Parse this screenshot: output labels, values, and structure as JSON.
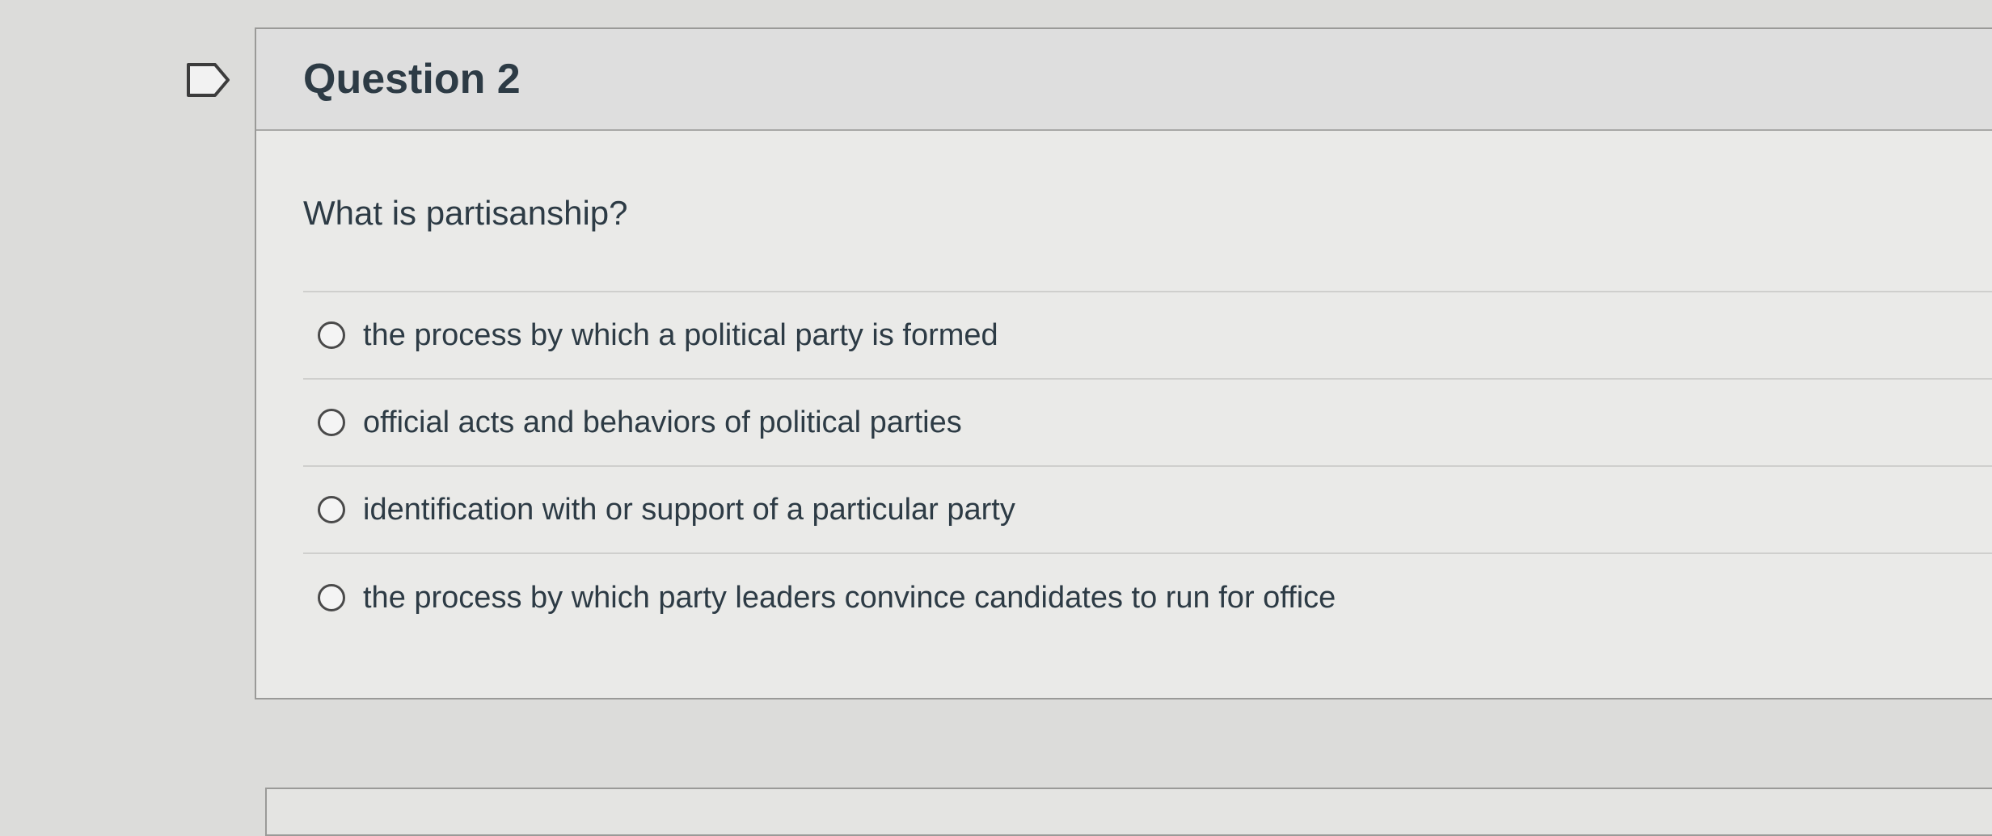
{
  "question": {
    "title": "Question 2",
    "prompt": "What is partisanship?",
    "flag_icon": "flag-outline-icon",
    "answers": [
      {
        "label": "the process by which a political party is formed",
        "selected": false
      },
      {
        "label": "official acts and behaviors of political parties",
        "selected": false
      },
      {
        "label": "identification with or support of a particular party",
        "selected": false
      },
      {
        "label": "the process by which party leaders convince candidates to run for office",
        "selected": false
      }
    ]
  }
}
